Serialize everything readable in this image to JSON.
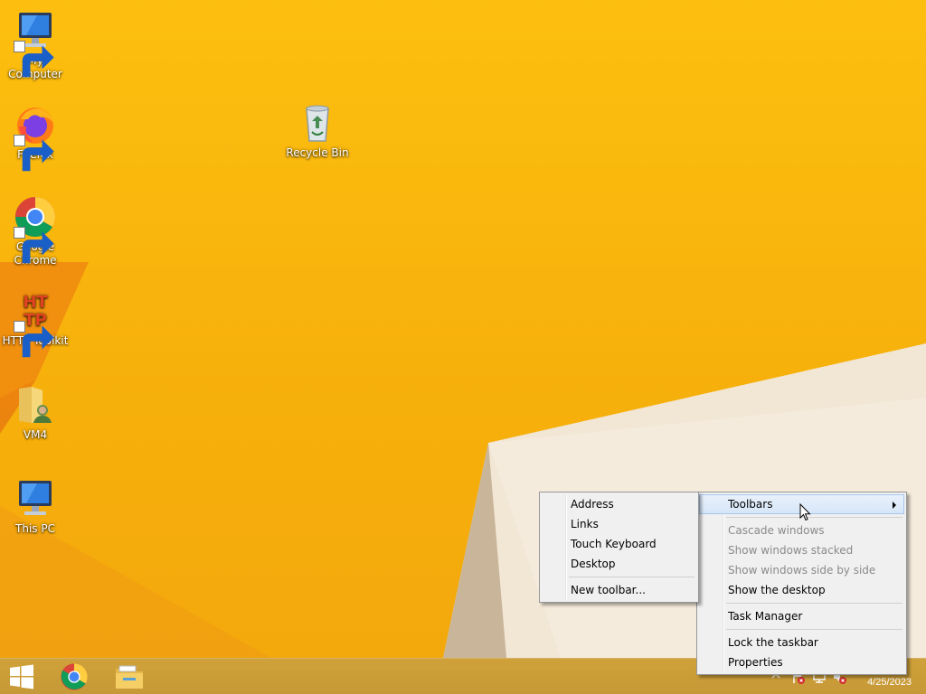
{
  "desktop": {
    "icons": [
      {
        "label": "My Computer"
      },
      {
        "label": "Firefox"
      },
      {
        "label": "Google Chrome"
      },
      {
        "label": "HTTP Toolkit"
      },
      {
        "label": "VM4"
      },
      {
        "label": "This PC"
      },
      {
        "label": "Recycle Bin"
      }
    ]
  },
  "taskbar_menu": {
    "toolbars": "Toolbars",
    "cascade": "Cascade windows",
    "stacked": "Show windows stacked",
    "side_by_side": "Show windows side by side",
    "show_desktop": "Show the desktop",
    "task_manager": "Task Manager",
    "lock": "Lock the taskbar",
    "properties": "Properties"
  },
  "toolbars_submenu": {
    "address": "Address",
    "links": "Links",
    "touch_keyboard": "Touch Keyboard",
    "desktop": "Desktop",
    "new_toolbar": "New toolbar..."
  },
  "tray": {
    "date": "4/25/2023"
  },
  "colors": {
    "wallpaper": "#f8b60a",
    "menu_bg": "#f0f0f0",
    "menu_highlight": "#d6e6f8"
  }
}
